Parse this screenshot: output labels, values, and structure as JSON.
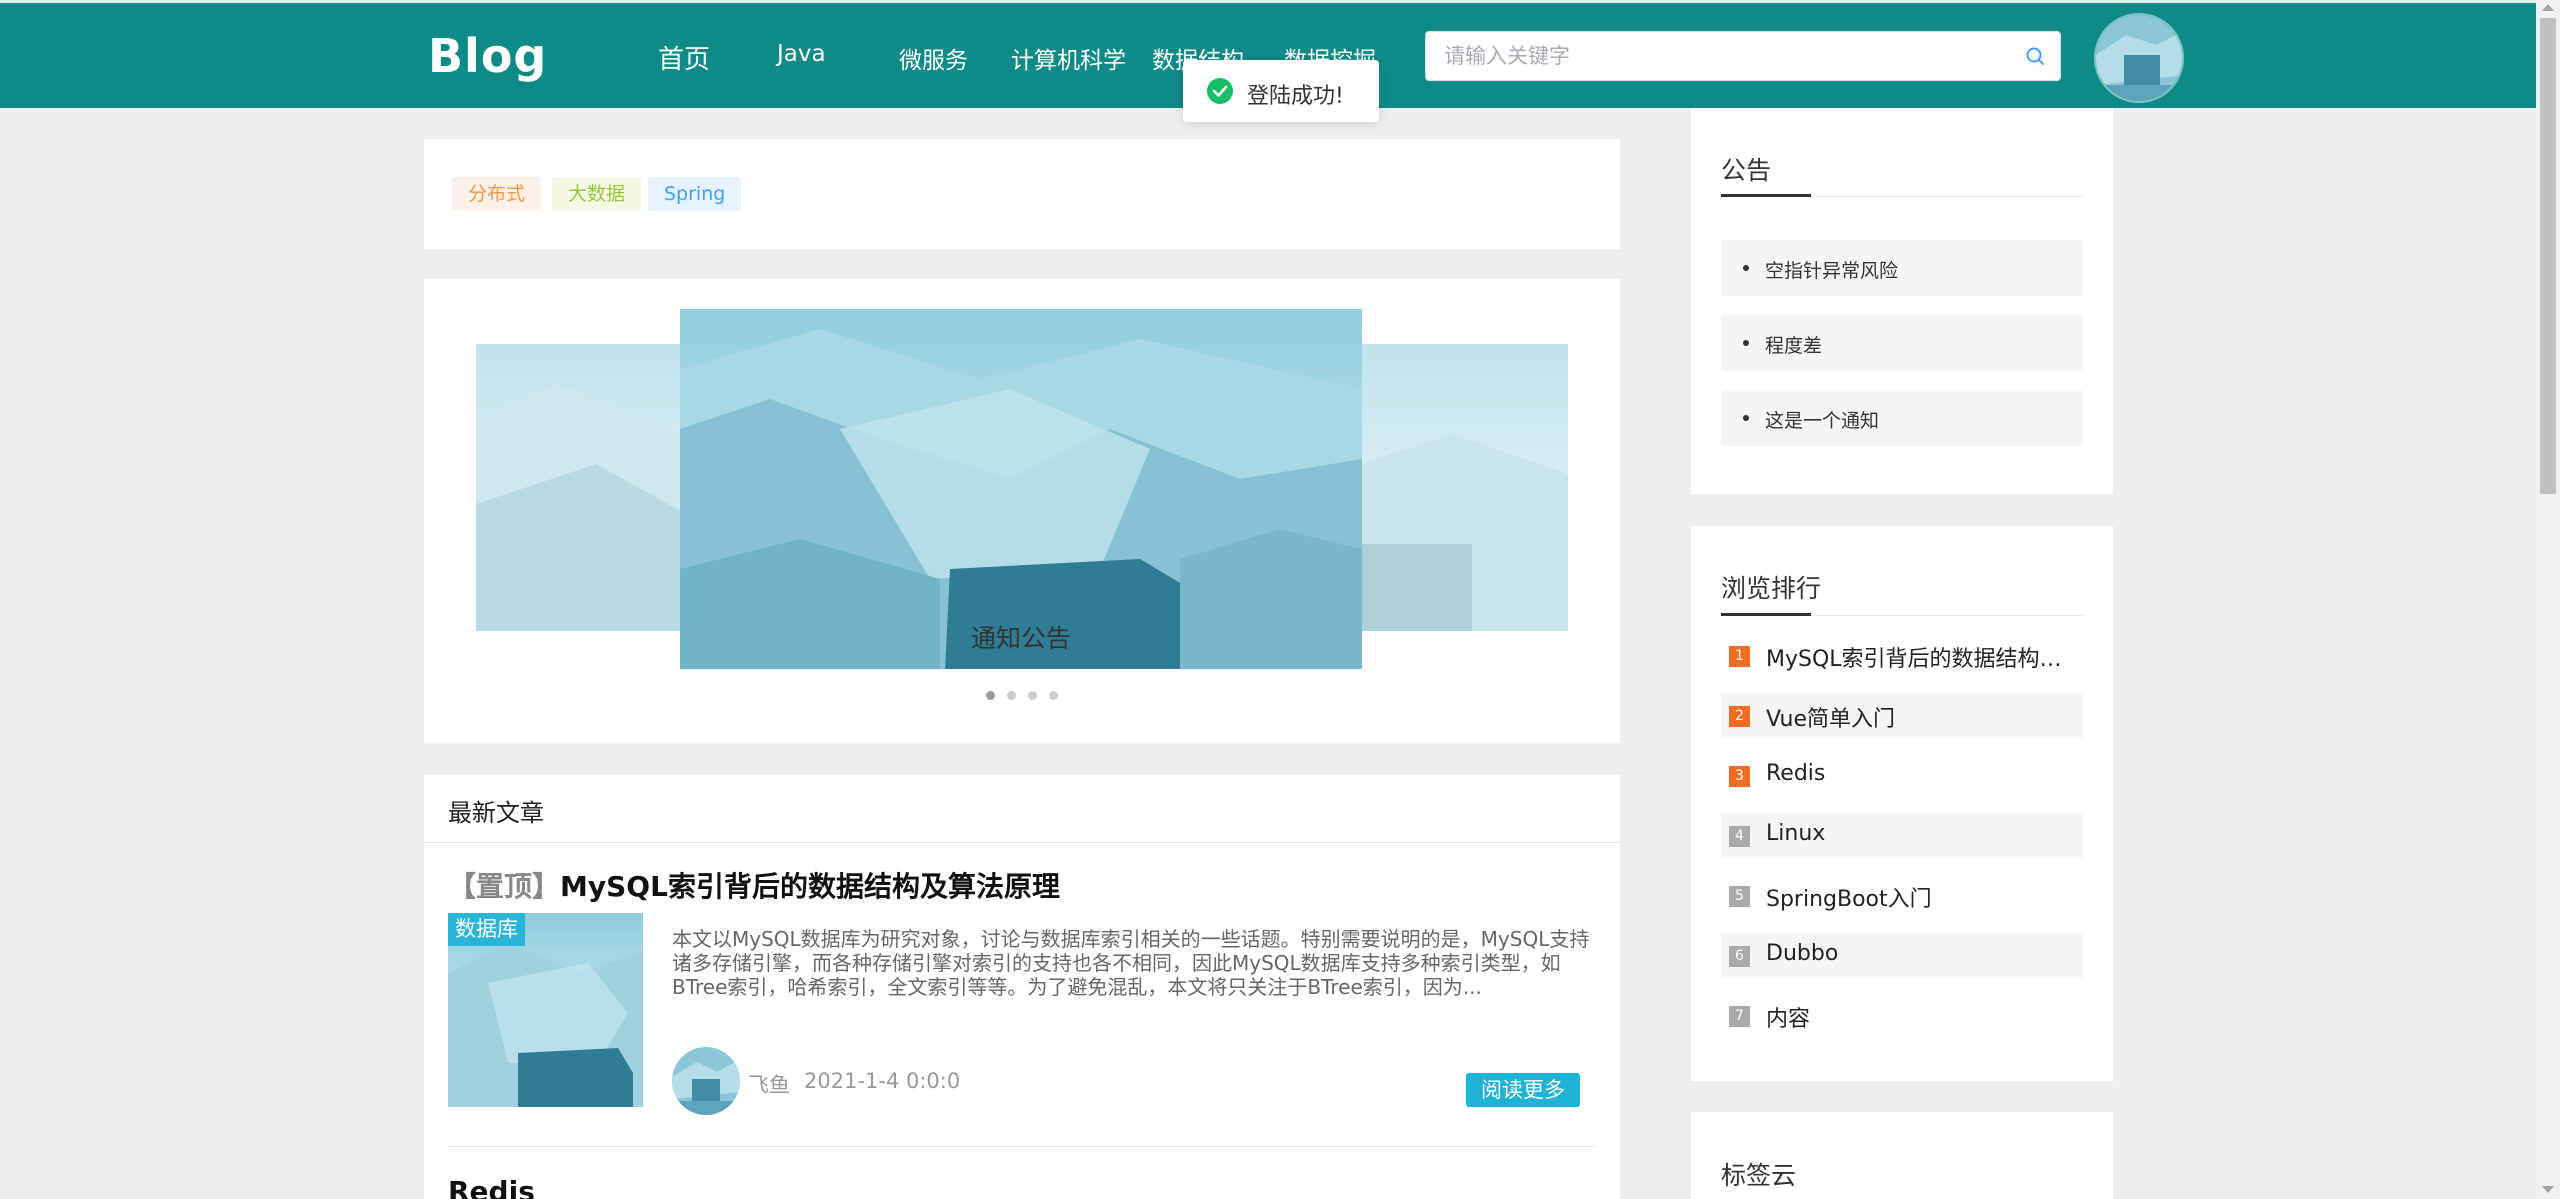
{
  "header": {
    "logo": "Blog",
    "nav": [
      "首页",
      "Java",
      "微服务",
      "计算机科学",
      "数据结构",
      "数据挖掘"
    ],
    "search_placeholder": "请输入关键字"
  },
  "toast": {
    "message": "登陆成功!"
  },
  "tags": [
    {
      "label": "分布式",
      "color": "#f2994a",
      "bg": "#fdf0e8"
    },
    {
      "label": "大数据",
      "color": "#9bc53d",
      "bg": "#f4f9e6"
    },
    {
      "label": "Spring",
      "color": "#409eff",
      "bg": "#e6f2fd"
    }
  ],
  "carousel": {
    "caption": "通知公告",
    "slides": 4,
    "active": 0
  },
  "articles": {
    "title": "最新文章",
    "items": [
      {
        "pin": "【置顶】",
        "title": "MySQL索引背后的数据结构及算法原理",
        "category": "数据库",
        "summary": "本文以MySQL数据库为研究对象，讨论与数据库索引相关的一些话题。特别需要说明的是，MySQL支持诸多存储引擎，而各种存储引擎对索引的支持也各不相同，因此MySQL数据库支持多种索引类型，如BTree索引，哈希索引，全文索引等等。为了避免混乱，本文将只关注于BTree索引，因为...",
        "author": "飞鱼",
        "date": "2021-1-4 0:0:0",
        "read_more": "阅读更多"
      },
      {
        "title": "Redis"
      }
    ]
  },
  "notice": {
    "title": "公告",
    "items": [
      "空指针异常风险",
      "程度差",
      "这是一个通知"
    ]
  },
  "ranking": {
    "title": "浏览排行",
    "items": [
      {
        "num": "1",
        "label": "MySQL索引背后的数据结构及算法原理",
        "color": "#f56c22"
      },
      {
        "num": "2",
        "label": "Vue简单入门",
        "color": "#f56c22"
      },
      {
        "num": "3",
        "label": "Redis",
        "color": "#f56c22"
      },
      {
        "num": "4",
        "label": "Linux",
        "color": "#aaaaaa"
      },
      {
        "num": "5",
        "label": "SpringBoot入门",
        "color": "#aaaaaa"
      },
      {
        "num": "6",
        "label": "Dubbo",
        "color": "#aaaaaa"
      },
      {
        "num": "7",
        "label": "内容",
        "color": "#aaaaaa"
      }
    ]
  },
  "tagcloud": {
    "title": "标签云"
  }
}
